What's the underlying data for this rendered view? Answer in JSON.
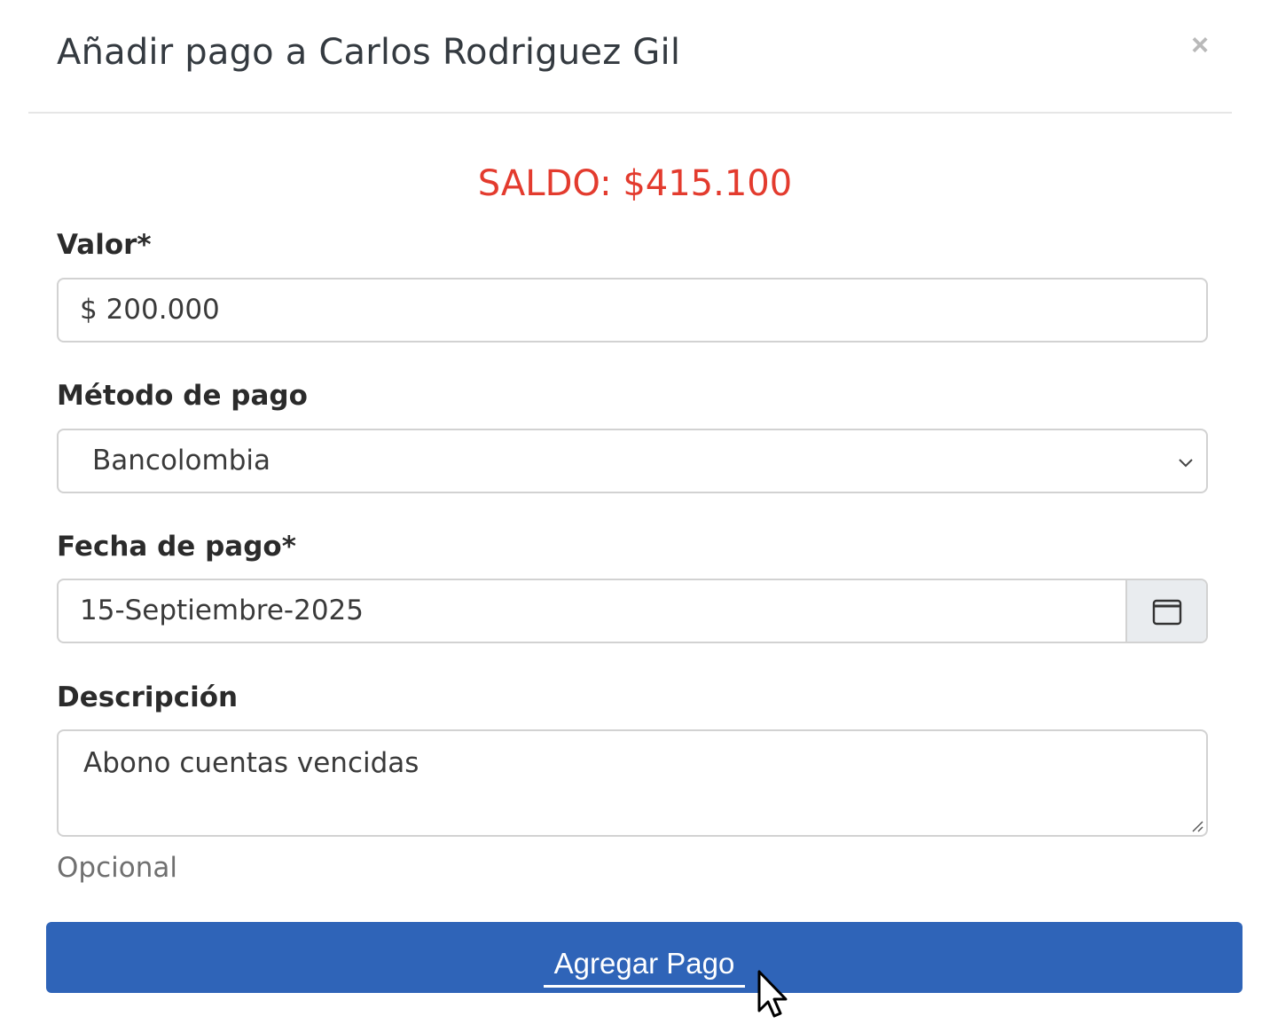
{
  "modal": {
    "title": "Añadir pago a Carlos Rodriguez Gil",
    "close_label": "×"
  },
  "balance": {
    "text": "SALDO: $415.100",
    "color": "#e33b2e"
  },
  "form": {
    "valor": {
      "label": "Valor*",
      "value": "$ 200.000"
    },
    "metodo": {
      "label": "Método de pago",
      "selected": "Bancolombia",
      "icon": "chevron-down-icon"
    },
    "fecha": {
      "label": "Fecha de pago*",
      "value": "15-Septiembre-2025",
      "icon": "calendar-icon"
    },
    "descripcion": {
      "label": "Descripción",
      "value": "Abono cuentas vencidas",
      "help": "Opcional"
    },
    "submit_label": "Agregar Pago"
  },
  "colors": {
    "primary": "#2f64b8",
    "danger": "#e33b2e",
    "border": "#d2d2d2"
  }
}
